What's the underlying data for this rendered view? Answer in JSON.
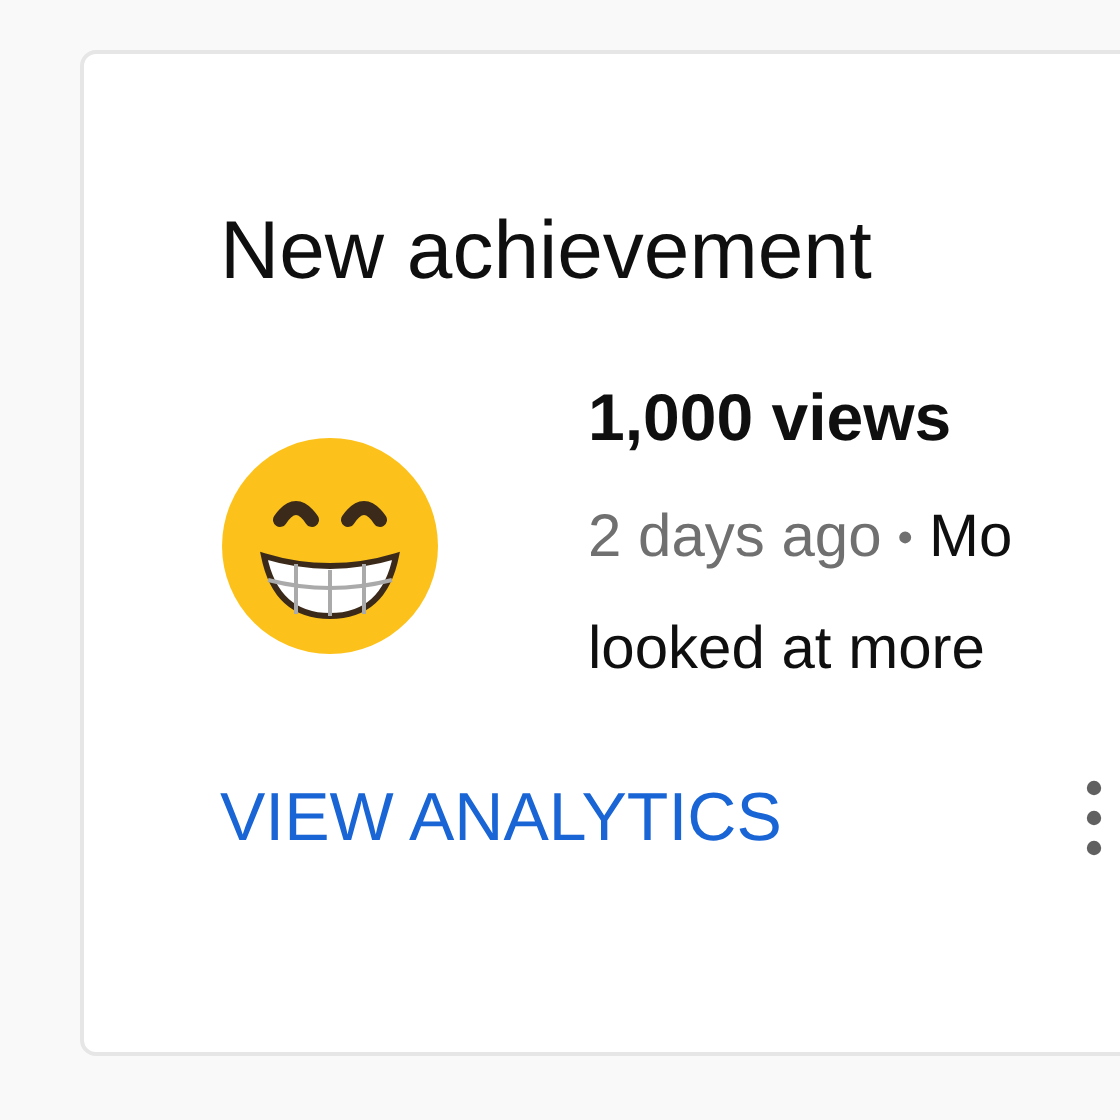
{
  "card": {
    "title": "New achievement",
    "milestone": "1,000 views",
    "date": "2 days ago",
    "separator": "•",
    "message_start": "Mo",
    "message_line_2": "looked at more",
    "action": "VIEW ANALYTICS"
  }
}
